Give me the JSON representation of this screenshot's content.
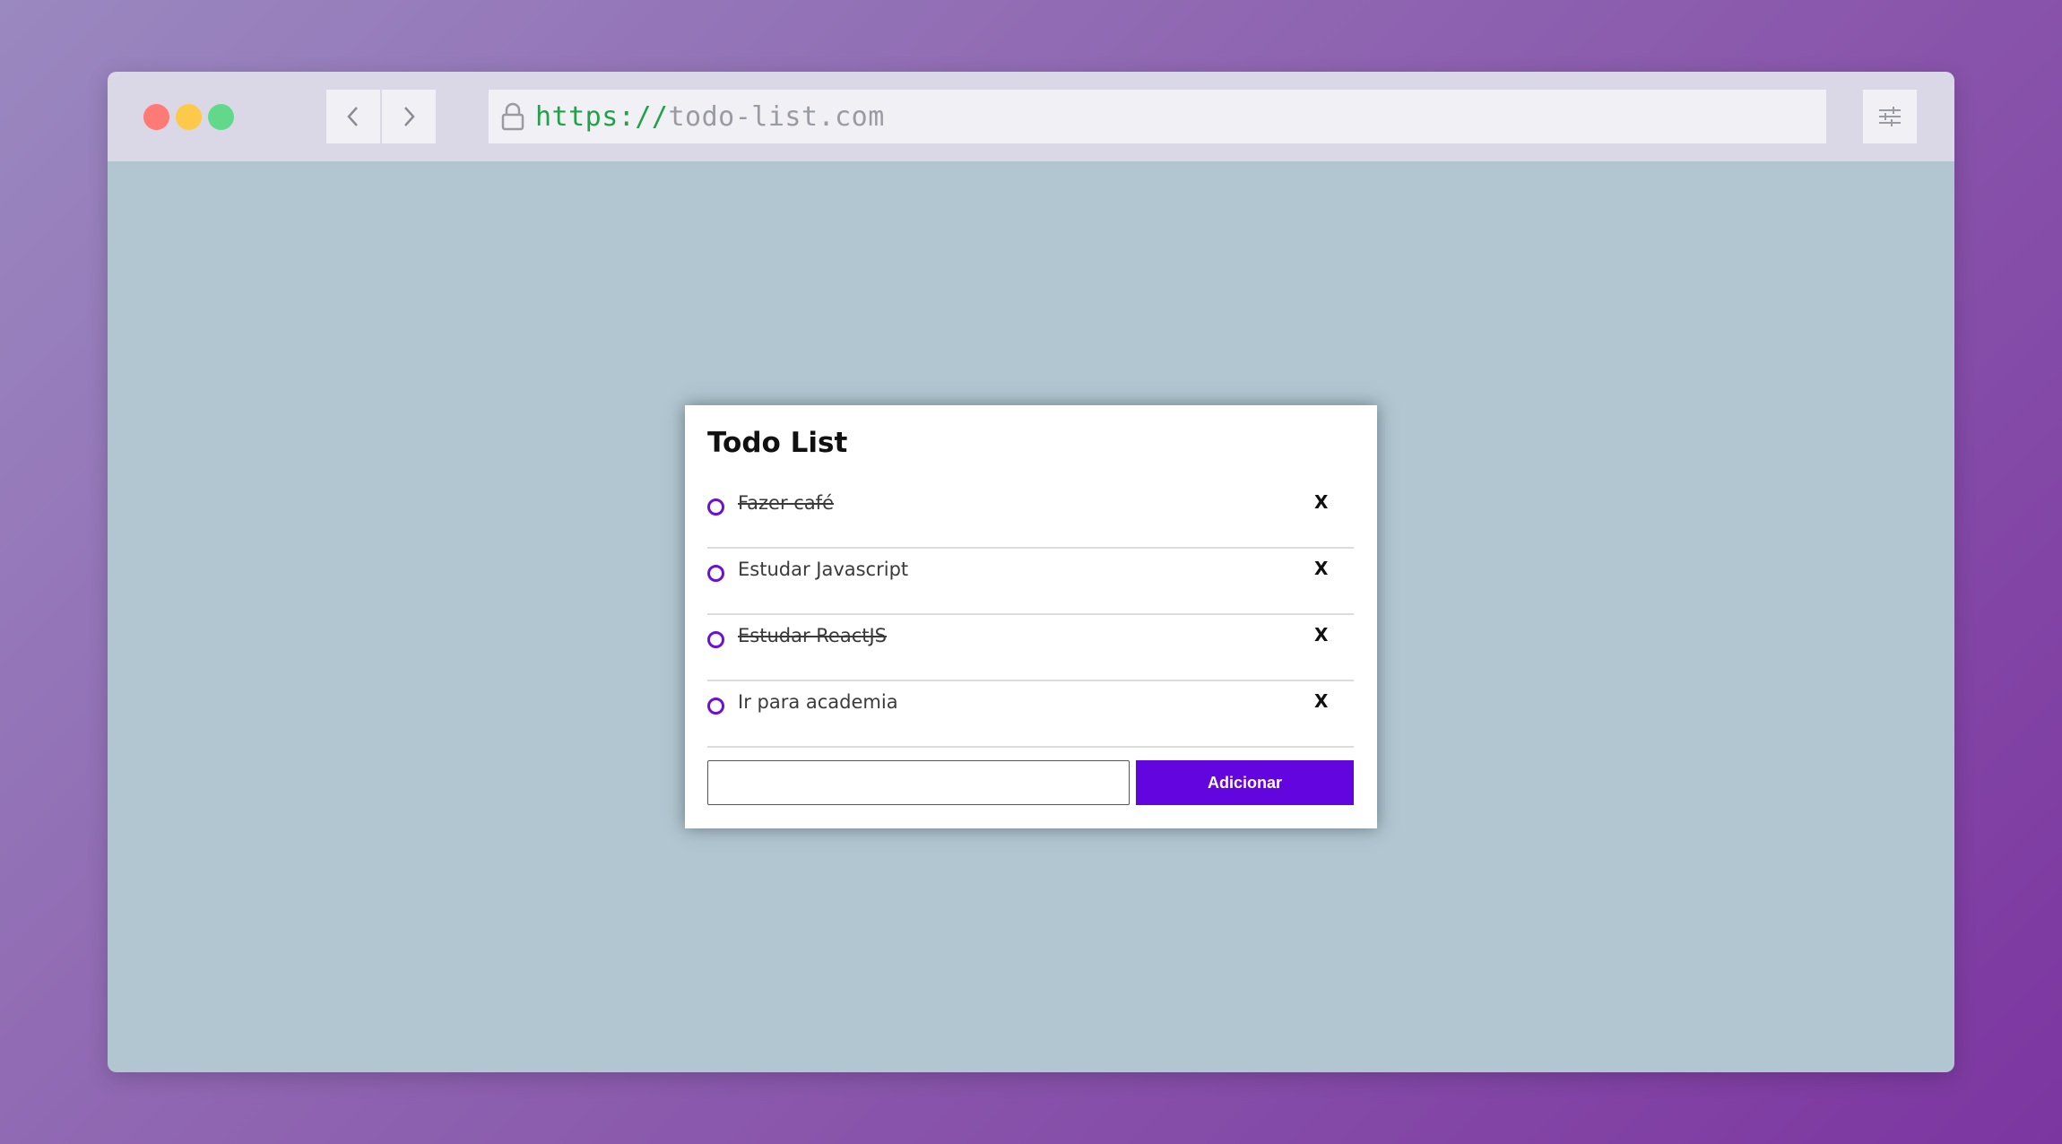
{
  "browser": {
    "address_bar": {
      "scheme": "https://",
      "host": "todo-list.com"
    },
    "icons": {
      "back": "chevron-left-icon",
      "forward": "chevron-right-icon",
      "lock": "lock-icon",
      "settings": "sliders-icon"
    },
    "traffic_light_colors": {
      "close": "#fe7b75",
      "minimize": "#fdc94a",
      "maximize": "#62d98a"
    }
  },
  "app": {
    "title": "Todo List",
    "items": [
      {
        "label": "Fazer café",
        "completed": true,
        "delete_label": "X"
      },
      {
        "label": "Estudar Javascript",
        "completed": false,
        "delete_label": "X"
      },
      {
        "label": "Estudar ReactJS",
        "completed": true,
        "delete_label": "X"
      },
      {
        "label": "Ir para academia",
        "completed": false,
        "delete_label": "X"
      }
    ],
    "new_item": {
      "value": "",
      "placeholder": ""
    },
    "add_button_label": "Adicionar",
    "accent_color": "#6205df"
  }
}
